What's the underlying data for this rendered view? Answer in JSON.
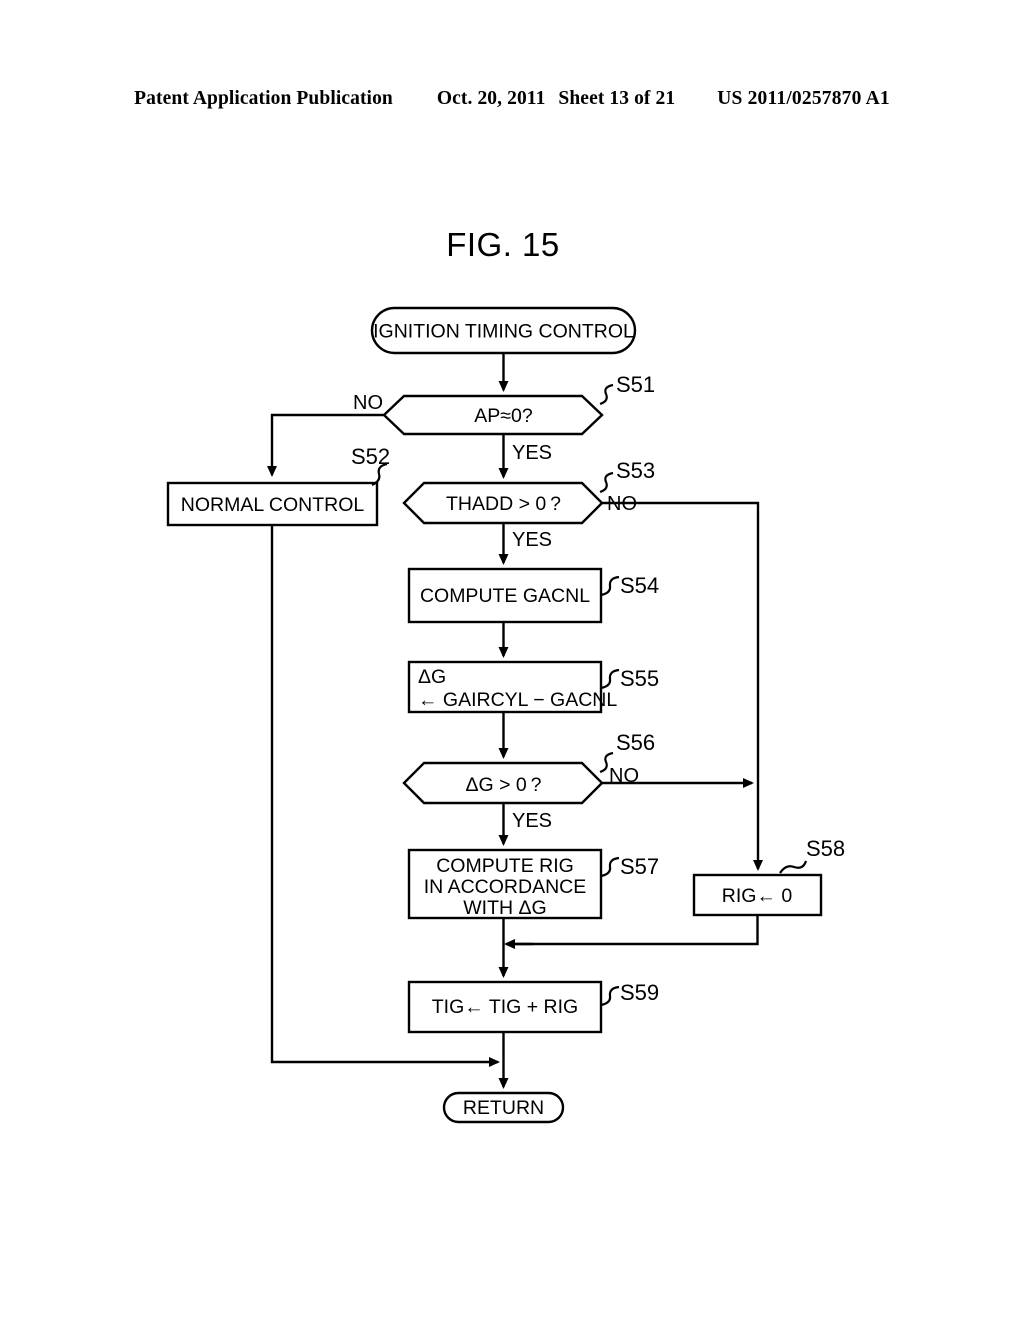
{
  "header": {
    "publication": "Patent Application Publication",
    "date": "Oct. 20, 2011",
    "sheet": "Sheet 13 of 21",
    "patent_number": "US 2011/0257870 A1"
  },
  "figure": {
    "title": "FIG. 15"
  },
  "flowchart": {
    "start": {
      "label": "IGNITION TIMING CONTROL"
    },
    "end": {
      "label": "RETURN"
    },
    "nodes": [
      {
        "id": "S51",
        "step": "S51",
        "shape": "decision",
        "label": "AP≈0?"
      },
      {
        "id": "S52",
        "step": "S52",
        "shape": "process",
        "label": "NORMAL CONTROL"
      },
      {
        "id": "S53",
        "step": "S53",
        "shape": "decision",
        "label": "THADD > 0 ?"
      },
      {
        "id": "S54",
        "step": "S54",
        "shape": "process",
        "label": "COMPUTE GACNL"
      },
      {
        "id": "S55",
        "step": "S55",
        "shape": "process",
        "line1": "ΔG",
        "line2": "← GAIRCYL − GACNL"
      },
      {
        "id": "S56",
        "step": "S56",
        "shape": "decision",
        "label": "ΔG > 0 ?"
      },
      {
        "id": "S57",
        "step": "S57",
        "shape": "process",
        "line1": "COMPUTE RIG",
        "line2": "IN ACCORDANCE",
        "line3": "WITH ΔG"
      },
      {
        "id": "S58",
        "step": "S58",
        "shape": "process",
        "label": "RIG← 0"
      },
      {
        "id": "S59",
        "step": "S59",
        "shape": "process",
        "label": "TIG← TIG + RIG"
      }
    ],
    "branch_labels": {
      "s51_no": "NO",
      "s51_yes": "YES",
      "s53_no": "NO",
      "s53_yes": "YES",
      "s56_no": "NO",
      "s56_yes": "YES"
    }
  }
}
